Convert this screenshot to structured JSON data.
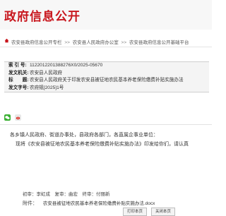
{
  "header": {
    "title": "政府信息公开"
  },
  "breadcrumb": {
    "items": [
      "农安县政府信息公开专栏",
      "农安县人民政府办公室",
      "农安县政府信息公开基础平台"
    ],
    "separator": ">>"
  },
  "meta": {
    "rows": [
      {
        "label": "索 引 号:",
        "value": "11220122013882​76X0/2025-05670"
      },
      {
        "label": "发文机关:",
        "value": "农安县人民政府"
      },
      {
        "label": "标　　题:",
        "value": "农安县人民政府关于印发农安县被征地农民基本养老保险缴费补贴实施办法"
      },
      {
        "label": "发文字号:",
        "value": "农府规[2025]1号"
      }
    ]
  },
  "body": {
    "salutation": "各乡镇人民政府、街道办事处，县政府各部门，各直属企事业单位：",
    "paragraph": "现将《农安县被征地农民基本养老保险缴费补贴实施办法》印发给你们，请认真"
  },
  "staff": "初审：李虹成　复审：曲宏　终审：付丽新",
  "attachment": {
    "label": "附件：",
    "file": "农安县被征地农民基本养老保险缴费补贴实施办法.docx"
  },
  "buttons": {
    "print": "打印本页",
    "close": "关闭本页"
  }
}
